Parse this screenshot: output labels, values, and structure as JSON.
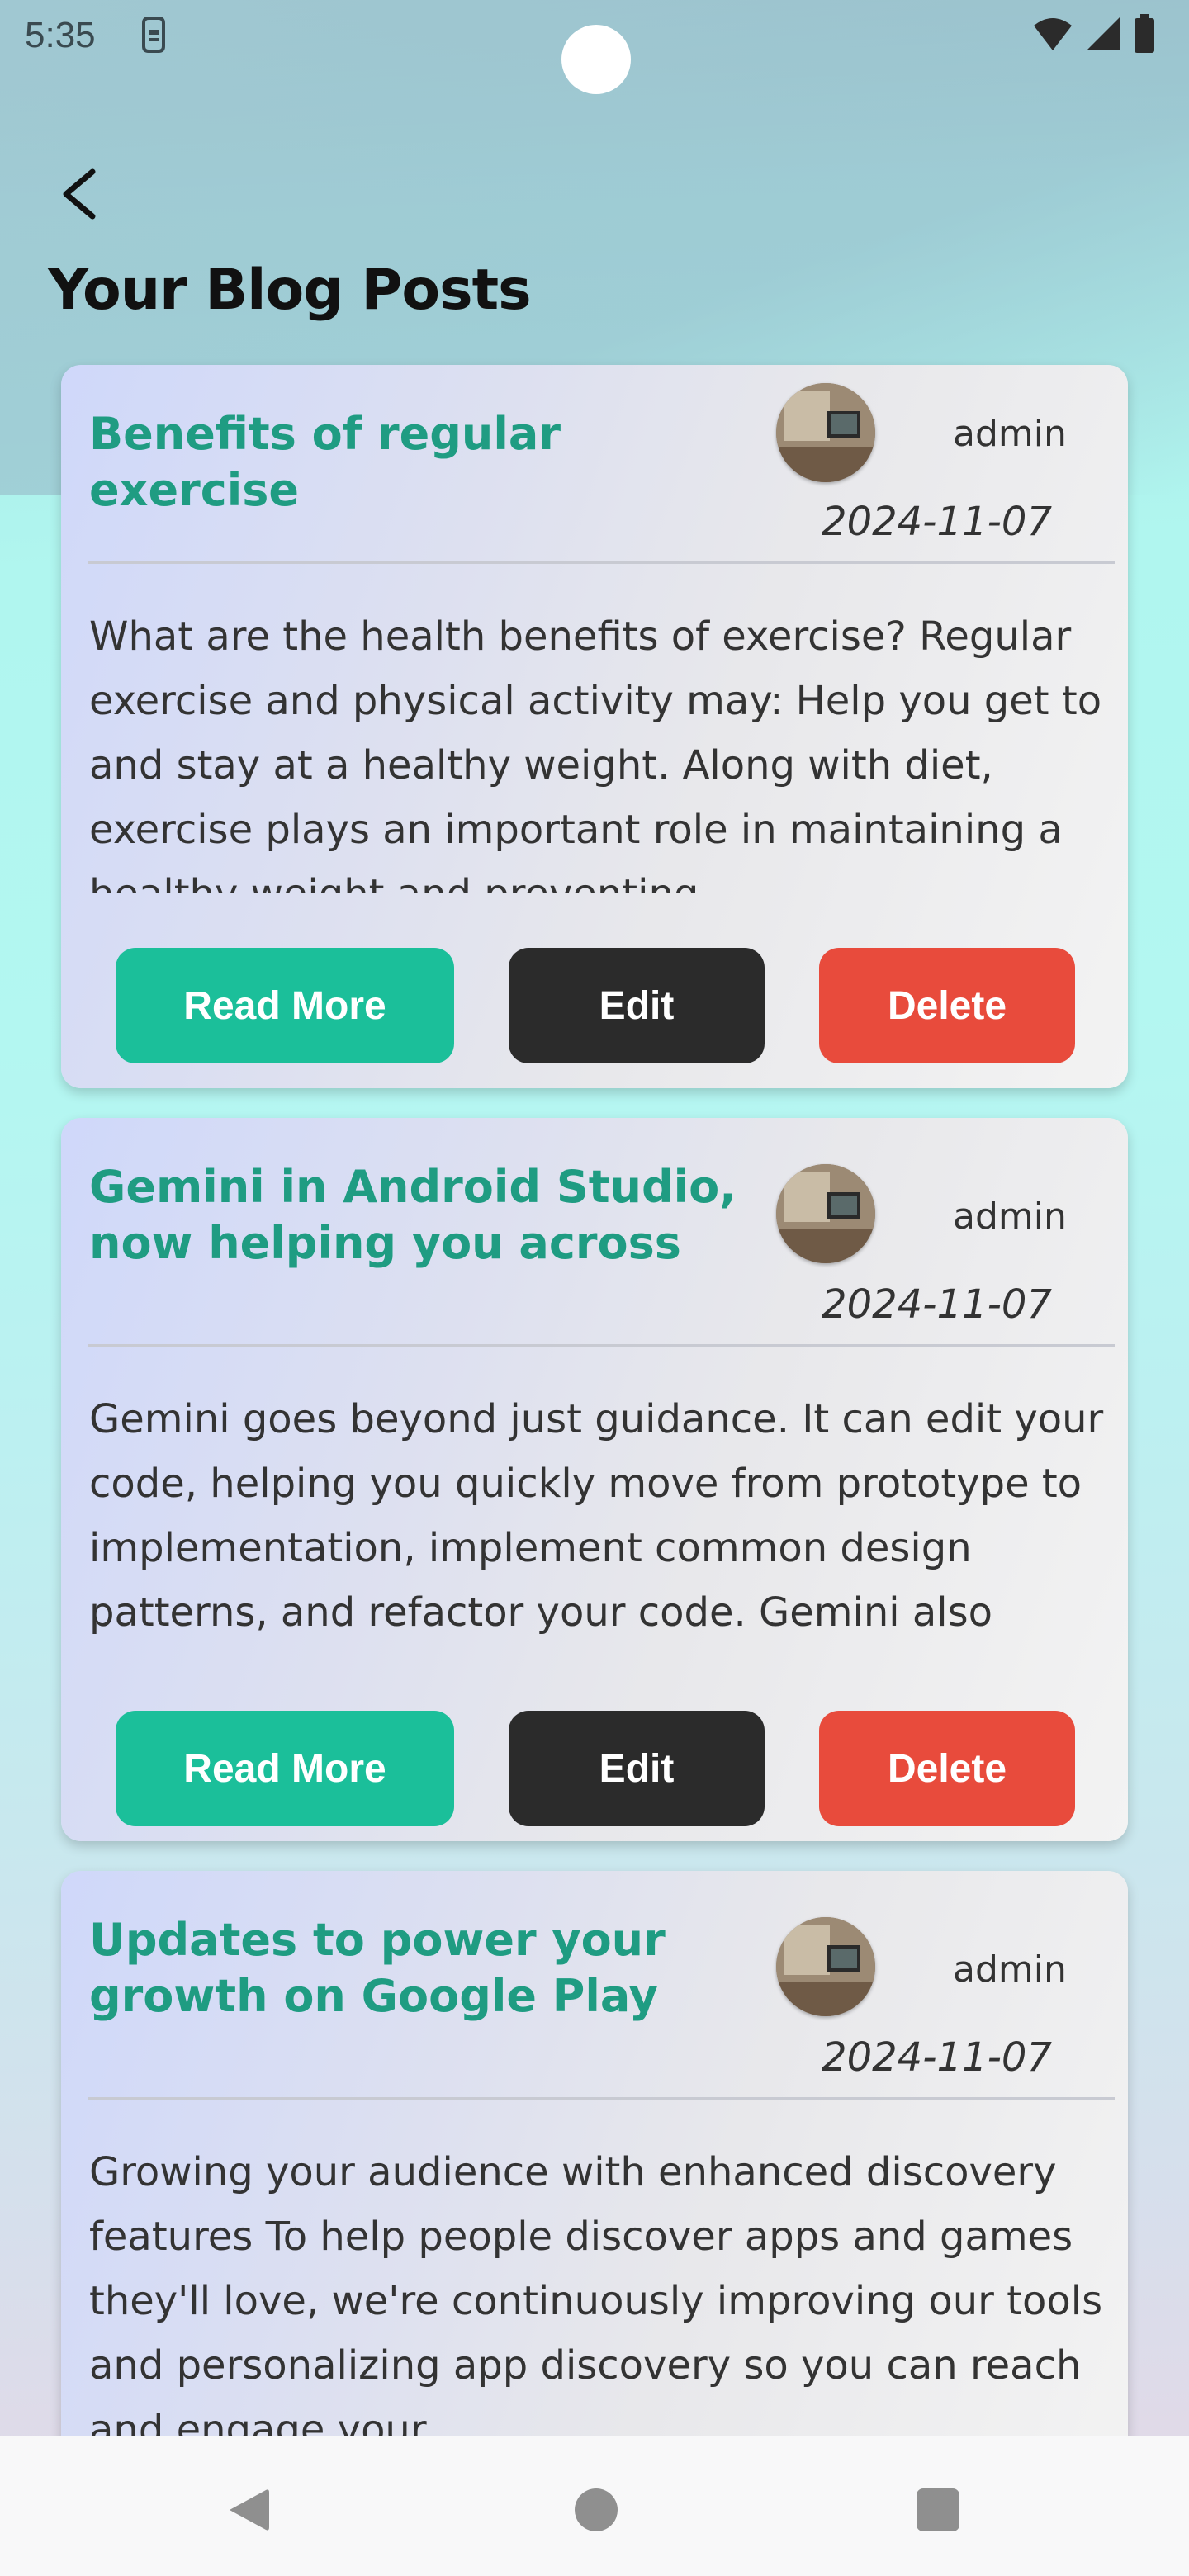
{
  "status_bar": {
    "time": "5:35"
  },
  "page": {
    "title": "Your Blog Posts"
  },
  "posts": [
    {
      "title": "Benefits of regular exercise",
      "author": "admin",
      "date": "2024-11-07",
      "body": "What are the health benefits of exercise? Regular exercise and physical activity may:  Help you get to and stay at a healthy weight. Along with diet, exercise plays an important role in maintaining a healthy weight and preventing"
    },
    {
      "title": "Gemini in Android Studio, now helping you across the",
      "author": "admin",
      "date": "2024-11-07",
      "body": "Gemini goes beyond just guidance. It can edit your code, helping you quickly move from prototype to implementation, implement common design patterns, and refactor your code. Gemini also streamlines your workflow"
    },
    {
      "title": "Updates to power your growth on Google Play",
      "author": "admin",
      "date": "2024-11-07",
      "body": "Growing your audience with enhanced discovery features To help people discover apps and games they'll love, we're continuously improving our tools and personalizing app discovery so you can reach and engage your"
    }
  ],
  "buttons": {
    "read_more": "Read More",
    "edit": "Edit",
    "delete": "Delete"
  },
  "colors": {
    "title_accent": "#1f9c82",
    "read_more": "#1bbf9a",
    "edit": "#2b2b2b",
    "delete": "#e84b3c"
  }
}
